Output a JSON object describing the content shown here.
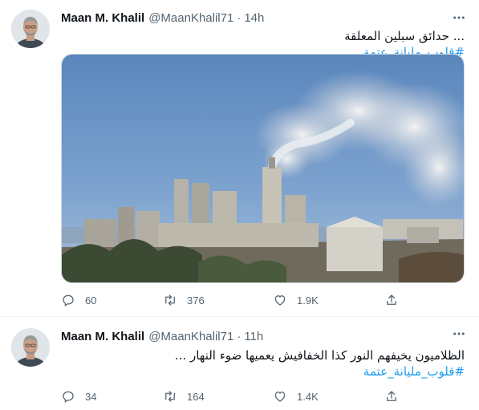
{
  "tweets": [
    {
      "author_name": "Maan M. Khalil",
      "handle": "@MaanKhalil71",
      "separator": "·",
      "time": "14h",
      "text_lines": [
        "... حدائق سبلين المعلقة"
      ],
      "hashtag": "#قلوب_مليانة_عتمة",
      "has_media": true,
      "replies": "60",
      "retweets": "376",
      "likes": "1.9K"
    },
    {
      "author_name": "Maan M. Khalil",
      "handle": "@MaanKhalil71",
      "separator": "·",
      "time": "11h",
      "text_lines": [
        "الظلاميون يخيفهم النور كذا الخفافيش يعميها ضوء النهار ..."
      ],
      "hashtag": "#قلوب_مليانة_عتمة",
      "has_media": false,
      "replies": "34",
      "retweets": "164",
      "likes": "1.4K"
    }
  ],
  "icons": {
    "more": "more-horizontal-icon",
    "reply": "reply-icon",
    "retweet": "retweet-icon",
    "like": "heart-icon",
    "share": "share-icon"
  },
  "colors": {
    "link": "#1d9bf0",
    "secondary_text": "#536471",
    "primary_text": "#0f1419",
    "divider": "#eff3f4"
  }
}
